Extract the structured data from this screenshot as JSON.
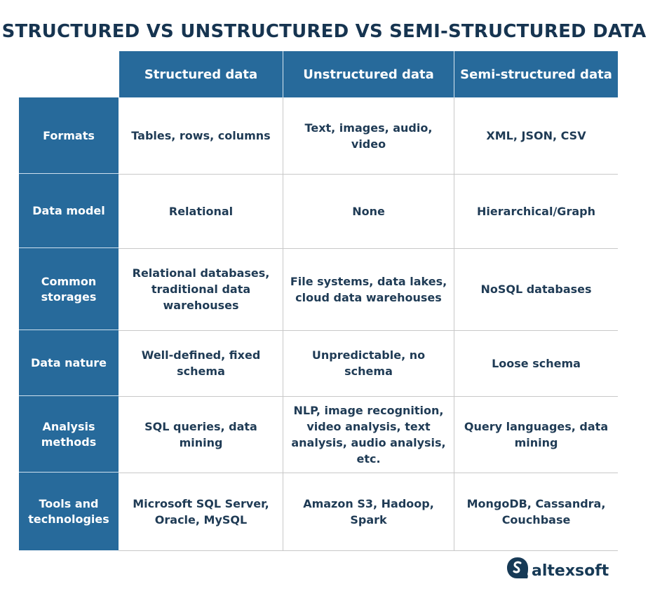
{
  "title": "STRUCTURED VS UNSTRUCTURED VS SEMI-STRUCTURED DATA",
  "columns": [
    "Structured data",
    "Unstructured data",
    "Semi-structured data"
  ],
  "rows": [
    {
      "label": "Formats",
      "cells": [
        "Tables, rows, columns",
        "Text, images, audio, video",
        "XML, JSON, CSV"
      ]
    },
    {
      "label": "Data model",
      "cells": [
        "Relational",
        "None",
        "Hierarchical/Graph"
      ]
    },
    {
      "label": "Common storages",
      "cells": [
        "Relational databases, traditional data warehouses",
        "File systems, data lakes, cloud data warehouses",
        "NoSQL databases"
      ]
    },
    {
      "label": "Data nature",
      "cells": [
        "Well-defined, fixed schema",
        "Unpredictable, no schema",
        "Loose schema"
      ]
    },
    {
      "label": "Analysis methods",
      "cells": [
        "SQL queries, data mining",
        "NLP, image recognition, video analysis, text analysis, audio analysis, etc.",
        "Query languages, data mining"
      ]
    },
    {
      "label": "Tools and technologies",
      "cells": [
        "Microsoft SQL Server, Oracle, MySQL",
        "Amazon S3, Hadoop, Spark",
        "MongoDB, Cassandra, Couchbase"
      ]
    }
  ],
  "logo": {
    "text": "altexsoft",
    "icon": "altexsoft-logo-icon"
  },
  "colors": {
    "header_bg": "#276a9b",
    "title": "#163450",
    "text": "#1f3b55"
  }
}
